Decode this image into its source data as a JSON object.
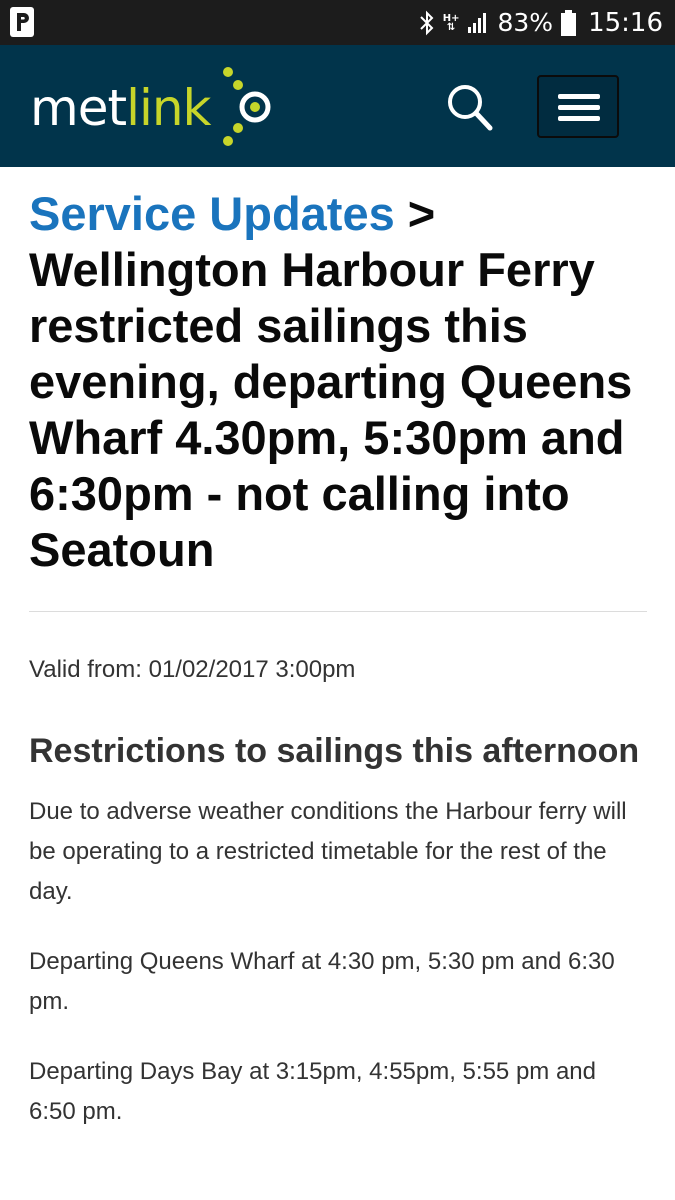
{
  "status_bar": {
    "network_label": "H+",
    "battery_percent": "83%",
    "time": "15:16"
  },
  "header": {
    "logo": {
      "text_main": "met",
      "text_accent": "link"
    },
    "search_icon": "search-icon",
    "menu_icon": "hamburger-menu-icon",
    "brand_color": "#01344b",
    "accent_color": "#c7d52a"
  },
  "page": {
    "breadcrumb_link": "Service Updates",
    "breadcrumb_separator": " > ",
    "title": "Wellington Harbour Ferry restricted sailings this evening, departing Queens Wharf 4.30pm, 5:30pm and 6:30pm - not calling into Seatoun",
    "valid_from": "Valid from: 01/02/2017 3:00pm",
    "subheading": "Restrictions to sailings this afternoon",
    "paragraphs": [
      "Due to adverse weather conditions the Harbour ferry will be operating to a restricted timetable for the rest of the day.",
      "Departing Queens Wharf at 4:30 pm, 5:30 pm and 6:30 pm.",
      "Departing Days Bay at 3:15pm, 4:55pm, 5:55 pm and 6:50 pm."
    ]
  }
}
